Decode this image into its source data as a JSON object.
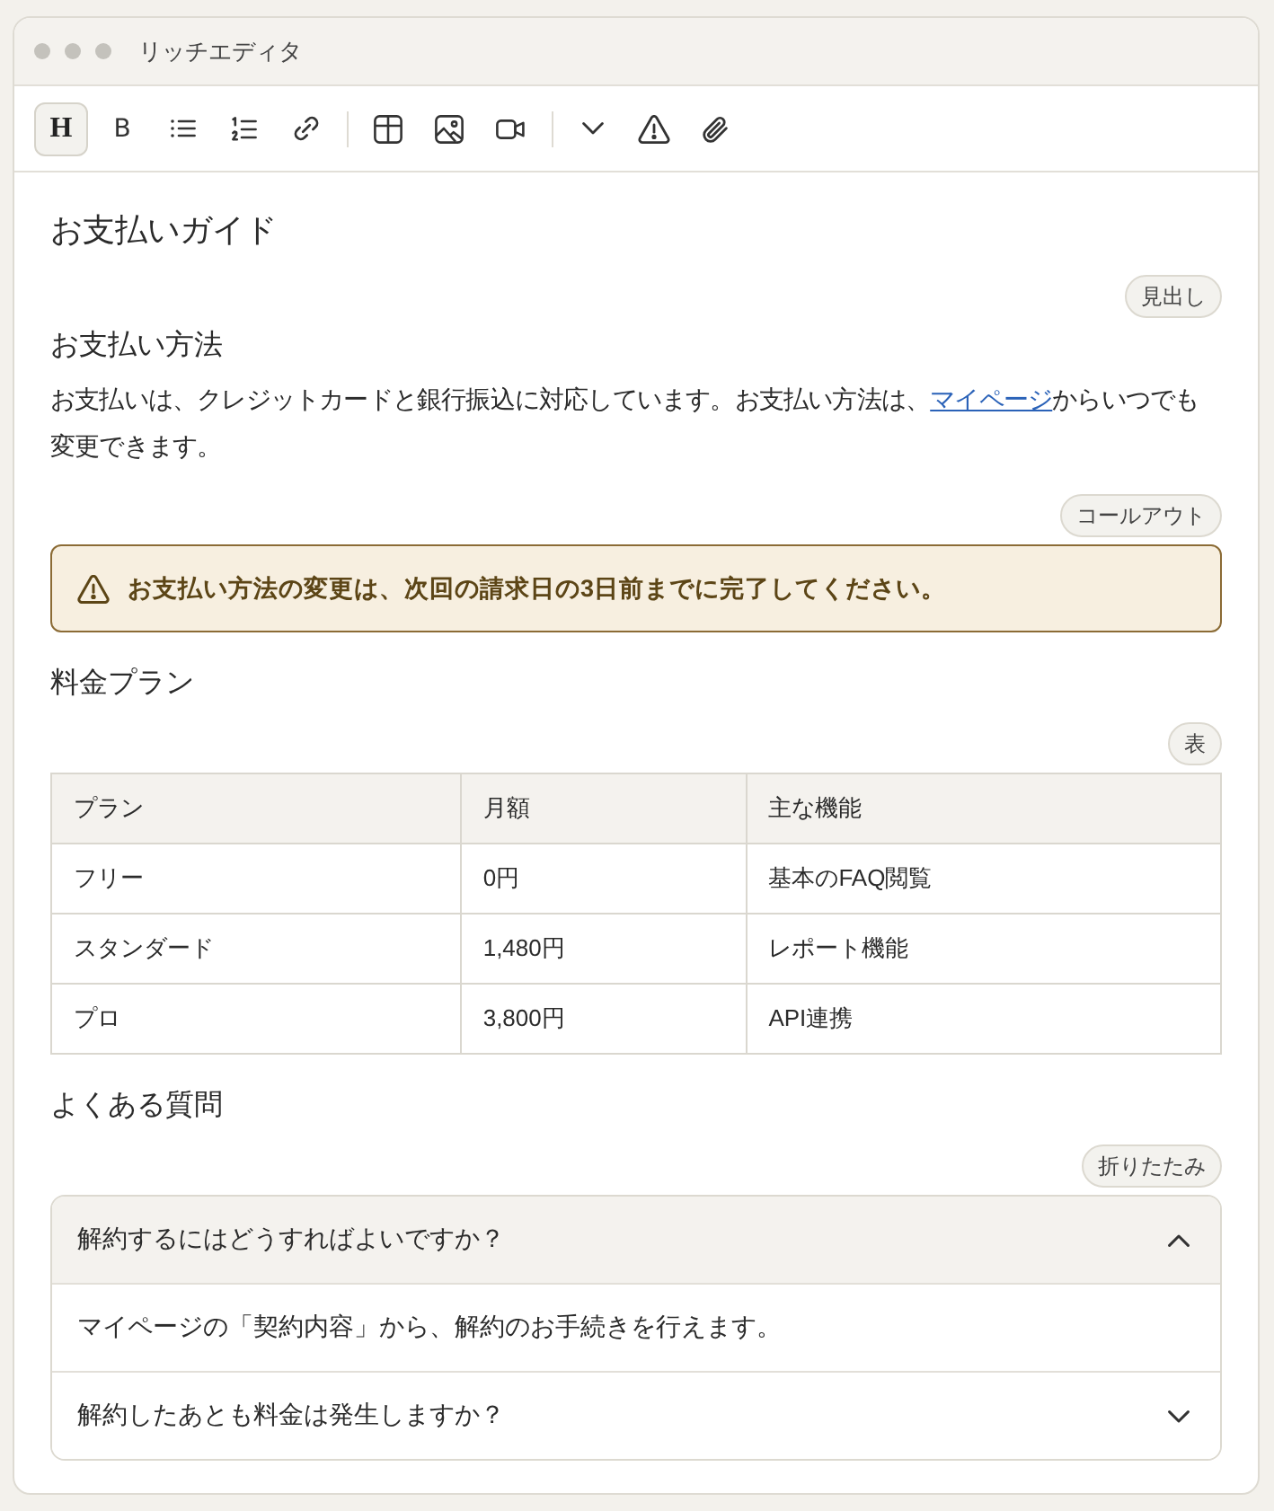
{
  "window": {
    "title": "リッチエディタ"
  },
  "toolbar": {
    "groups": [
      {
        "buttons": [
          {
            "kind": "heading",
            "label": "H",
            "selected": true
          },
          {
            "kind": "bold",
            "label": "B",
            "selected": false
          },
          {
            "kind": "bullet-list",
            "selected": false
          },
          {
            "kind": "numbered-list",
            "selected": false
          },
          {
            "kind": "link",
            "selected": false
          }
        ]
      },
      {
        "buttons": [
          {
            "kind": "table",
            "selected": false
          },
          {
            "kind": "image",
            "selected": false
          },
          {
            "kind": "video",
            "selected": false
          }
        ]
      },
      {
        "buttons": [
          {
            "kind": "more",
            "selected": false
          },
          {
            "kind": "callout",
            "selected": false
          },
          {
            "kind": "attachment",
            "selected": false
          }
        ]
      }
    ]
  },
  "document": {
    "title": "お支払いガイド",
    "blocks": [
      {
        "kind": "heading",
        "badge": "見出し",
        "text": "お支払い方法"
      },
      {
        "kind": "paragraph",
        "text_before": "お支払いは、クレジットカードと銀行振込に対応しています。お支払い方法は、",
        "link": "マイページ",
        "text_after": "からいつでも変更できます。"
      },
      {
        "kind": "callout",
        "badge": "コールアウト",
        "text": "お支払い方法の変更は、次回の請求日の3日前までに完了してください。"
      },
      {
        "kind": "heading",
        "text": "料金プラン"
      },
      {
        "kind": "table",
        "badge": "表",
        "columns": [
          "プラン",
          "月額",
          "主な機能"
        ],
        "rows": [
          [
            "フリー",
            "0円",
            "基本のFAQ閲覧"
          ],
          [
            "スタンダード",
            "1,480円",
            "レポート機能"
          ],
          [
            "プロ",
            "3,800円",
            "API連携"
          ]
        ]
      },
      {
        "kind": "heading",
        "text": "よくある質問"
      },
      {
        "kind": "accordion",
        "badge": "折りたたみ",
        "items": [
          {
            "question": "解約するにはどうすればよいですか？",
            "expanded": true,
            "answer": "マイページの「契約内容」から、解約のお手続きを行えます。"
          },
          {
            "question": "解約したあとも料金は発生しますか？",
            "expanded": false
          }
        ]
      }
    ]
  }
}
